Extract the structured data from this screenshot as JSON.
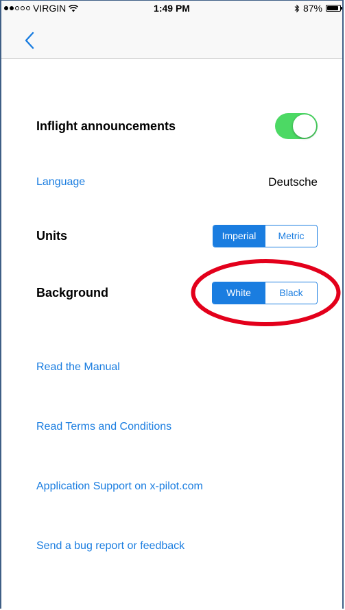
{
  "status_bar": {
    "carrier": "VIRGIN",
    "time": "1:49 PM",
    "battery_percent": "87%",
    "battery_level": 0.87,
    "signal_bars_filled": 2,
    "signal_bars_total": 5,
    "icons": [
      "wifi-icon",
      "bluetooth-icon",
      "battery-icon"
    ]
  },
  "nav": {
    "back_icon": "chevron-left-icon"
  },
  "settings": {
    "inflight": {
      "label": "Inflight announcements",
      "enabled": true
    },
    "language": {
      "label": "Language",
      "value": "Deutsche"
    },
    "units": {
      "label": "Units",
      "options": [
        "Imperial",
        "Metric"
      ],
      "selected": "Imperial"
    },
    "background": {
      "label": "Background",
      "options": [
        "White",
        "Black"
      ],
      "selected": "White"
    }
  },
  "links": {
    "manual": "Read the Manual",
    "terms": "Read Terms and Conditions",
    "support": "Application Support on x-pilot.com",
    "feedback": "Send a bug report or feedback"
  },
  "colors": {
    "accent": "#1a7de0",
    "toggle_on": "#4cd964",
    "annotation": "#e3001b"
  }
}
